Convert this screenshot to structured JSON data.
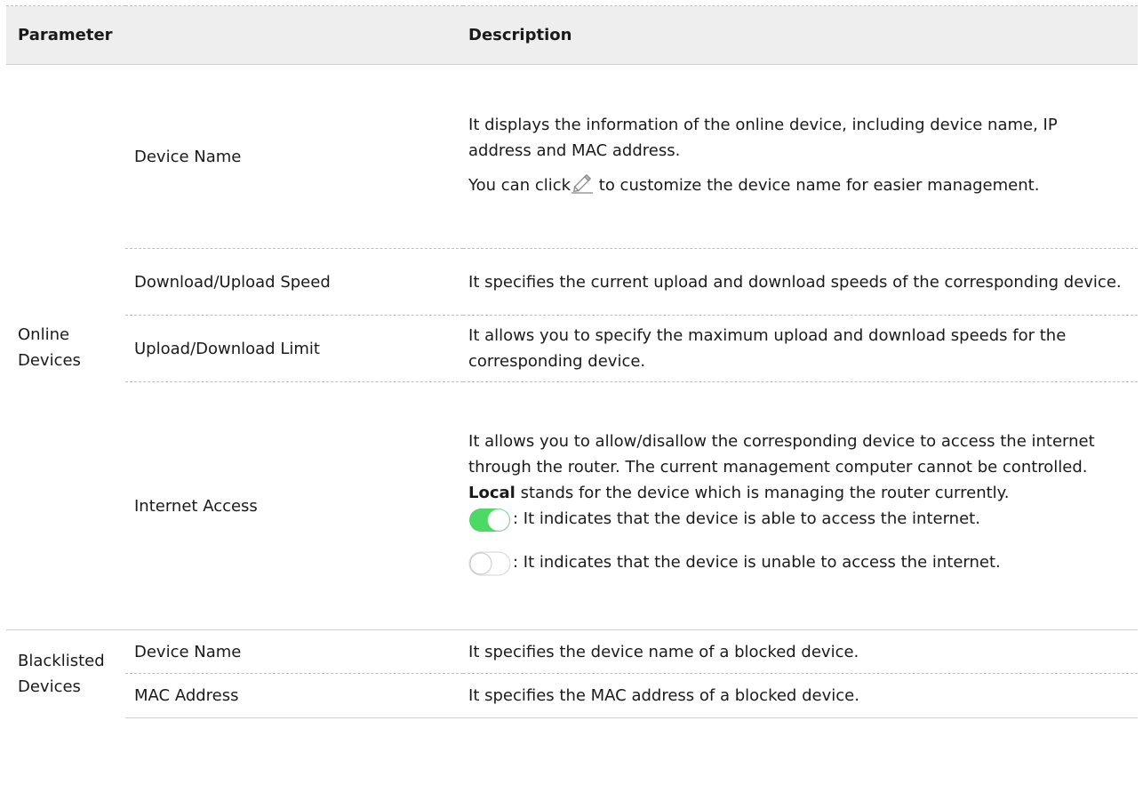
{
  "header": {
    "parameter": "Parameter",
    "description": "Description"
  },
  "online": {
    "group_label": "Online Devices",
    "device_name": {
      "label": "Device Name",
      "desc1": "It displays the information of the online device, including device name, IP address and MAC address.",
      "desc2_before": "You can click",
      "desc2_after": " to customize the device name for easier management."
    },
    "speed": {
      "label": "Download/Upload Speed",
      "desc": "It specifies the current upload and download speeds of the corresponding device."
    },
    "limit": {
      "label": "Upload/Download Limit",
      "desc": "It allows you to specify the maximum upload and download speeds for the corresponding device."
    },
    "internet": {
      "label": "Internet Access",
      "desc_before": "It allows you to allow/disallow the corresponding device to access the internet through the router. The current management computer cannot be controlled. ",
      "desc_bold": "Local",
      "desc_after": " stands for the device which is managing the router currently.",
      "on_desc": ": It indicates that the device is able to access the internet.",
      "off_desc": ": It indicates that the device is unable to access the internet."
    }
  },
  "blacklisted": {
    "group_label": "Blacklisted Devices",
    "device_name": {
      "label": "Device Name",
      "desc": "It specifies the device name of a blocked device."
    },
    "mac": {
      "label": "MAC Address",
      "desc": "It specifies the MAC address of a blocked device."
    }
  },
  "icons": {
    "edit": "pencil-icon",
    "toggle_on": "toggle-on-icon",
    "toggle_off": "toggle-off-icon"
  },
  "colors": {
    "header_bg": "#eeeeee",
    "toggle_on": "#4cd964"
  }
}
